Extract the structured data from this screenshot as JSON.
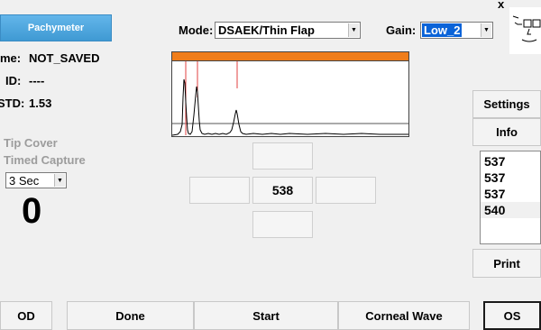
{
  "header": {
    "pachymeter_label": "Pachymeter",
    "mode_label": "Mode:",
    "mode_value": "DSAEK/Thin Flap",
    "gain_label": "Gain:",
    "gain_value": "Low_2",
    "close_label": "x"
  },
  "info": {
    "name_label": "me:",
    "name_value": "NOT_SAVED",
    "id_label": "ID:",
    "id_value": "----",
    "std_label": "STD:",
    "std_value": "1.53"
  },
  "options": {
    "tip_cover": "Tip Cover",
    "timed_capture": "Timed Capture",
    "timer_value": "3 Sec",
    "countdown": "0"
  },
  "center": {
    "reading": "538"
  },
  "right_panel": {
    "settings_label": "Settings",
    "info_label": "Info",
    "readings": [
      "537",
      "537",
      "537",
      "540"
    ],
    "print_label": "Print"
  },
  "bottom": {
    "od_label": "OD",
    "done_label": "Done",
    "start_label": "Start",
    "corneal_wave_label": "Corneal Wave",
    "os_label": "OS"
  },
  "colors": {
    "pachymeter_button": "#48a7df",
    "waveform_bar": "#f07d1a",
    "gain_highlight": "#0a63d8"
  }
}
